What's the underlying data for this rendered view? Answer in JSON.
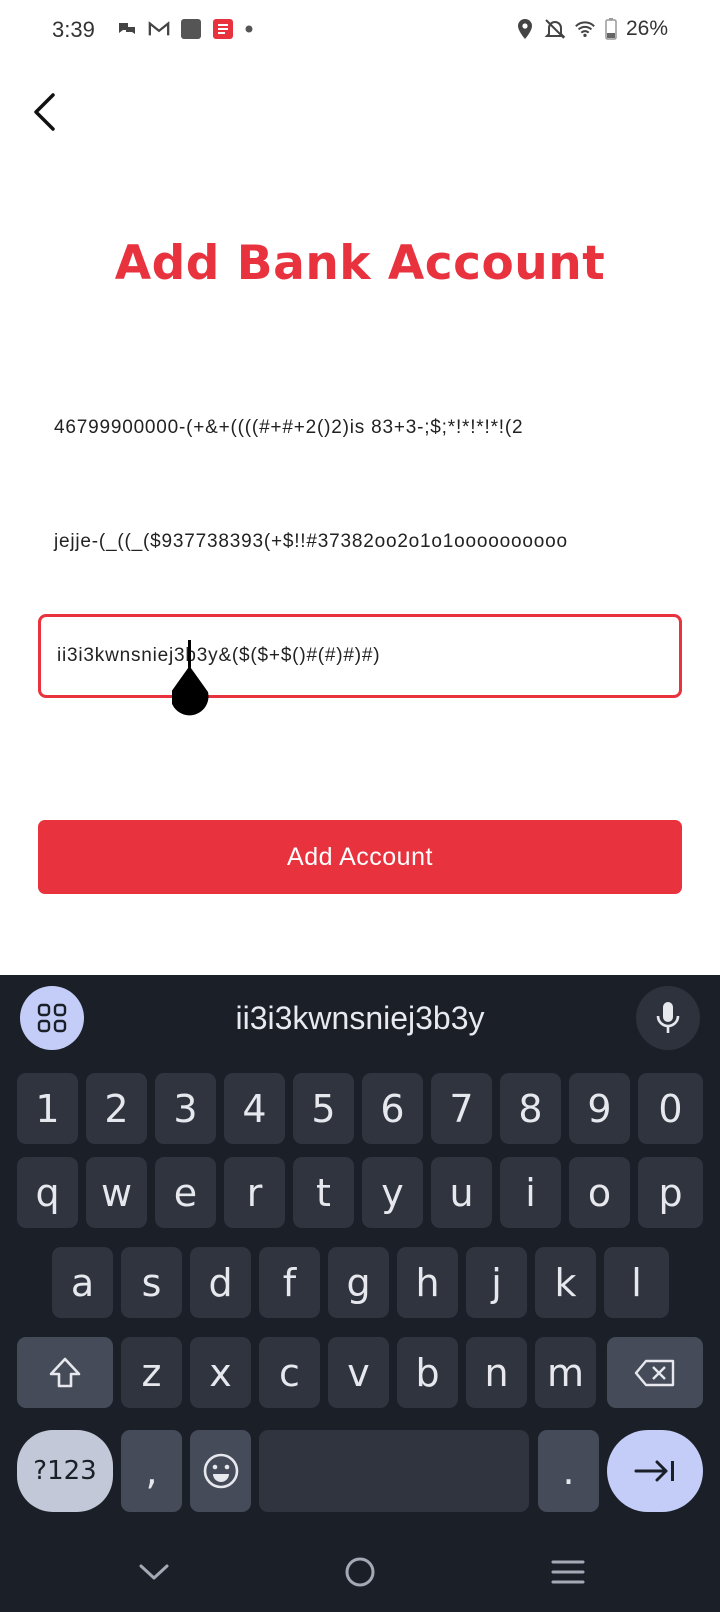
{
  "status_bar": {
    "time": "3:39",
    "battery": "26%",
    "icons_left": [
      "chat-icon",
      "gmail-icon",
      "app-square-icon",
      "app-red-icon",
      "dot-icon"
    ],
    "icons_right": [
      "location-icon",
      "bell-off-icon",
      "wifi-icon",
      "battery-icon"
    ]
  },
  "header": {
    "back_icon": "chevron-left-icon",
    "title": "Add Bank Account"
  },
  "form": {
    "field1_value": "46799900000-(+&+((((#+#+2()2)is 83+3-;$;*!*!*!*!(2",
    "field2_value": "jejje-(_((_($937738393(+$!!#37382oo2o1o1oooooooooo",
    "field3_value": "ii3i3kwnsniej3b3y&($($+$()#(#)#)#)",
    "submit_label": "Add Account"
  },
  "keyboard": {
    "suggestion": "ii3i3kwnsniej3b3y",
    "row_numbers": [
      "1",
      "2",
      "3",
      "4",
      "5",
      "6",
      "7",
      "8",
      "9",
      "0"
    ],
    "row_q": [
      "q",
      "w",
      "e",
      "r",
      "t",
      "y",
      "u",
      "i",
      "o",
      "p"
    ],
    "row_a": [
      "a",
      "s",
      "d",
      "f",
      "g",
      "h",
      "j",
      "k",
      "l"
    ],
    "row_z": [
      "z",
      "x",
      "c",
      "v",
      "b",
      "n",
      "m"
    ],
    "symbols_label": "?123",
    "comma_label": ",",
    "period_label": "."
  },
  "colors": {
    "accent": "#e8333f",
    "keyboard_bg": "#1b1f27",
    "key_bg": "#2f343e"
  }
}
